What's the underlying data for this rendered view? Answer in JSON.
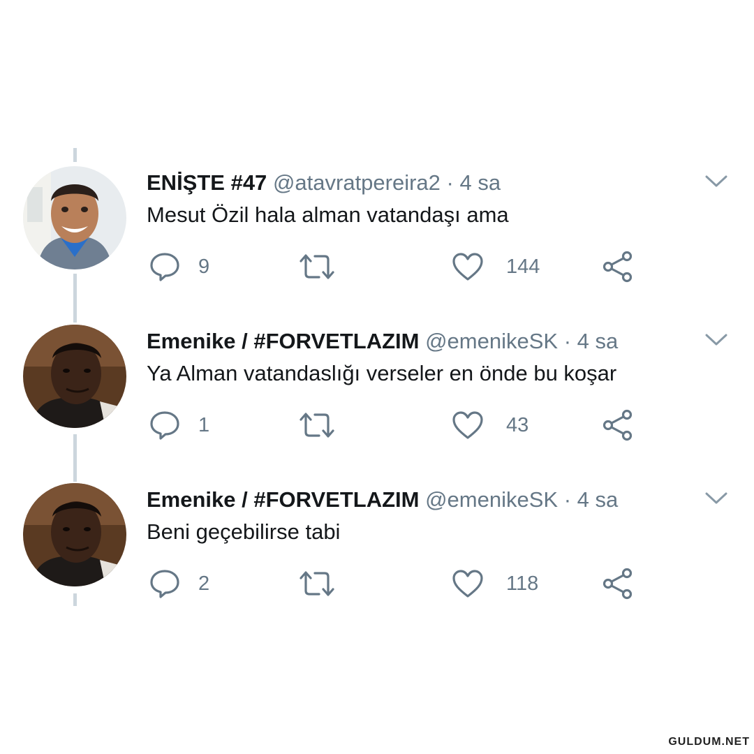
{
  "tweets": [
    {
      "name": "ENİŞTE #47",
      "handle": "@atavratpereira2",
      "separator": "·",
      "time": "4 sa",
      "text": "Mesut Özil hala alman vatandaşı ama",
      "replies": "9",
      "retweets": "",
      "likes": "144"
    },
    {
      "name": "Emenike / #FORVETLAZIM",
      "handle": "@emenikeSK",
      "separator": "·",
      "time": "4 sa",
      "text": "Ya Alman vatandaslığı verseler en önde bu koşar",
      "replies": "1",
      "retweets": "",
      "likes": "43"
    },
    {
      "name": "Emenike / #FORVETLAZIM",
      "handle": "@emenikeSK",
      "separator": "·",
      "time": "4 sa",
      "text": "Beni geçebilirse tabi",
      "replies": "2",
      "retweets": "",
      "likes": "118"
    }
  ],
  "icons": {
    "reply": "reply-icon",
    "retweet": "retweet-icon",
    "like": "heart-icon",
    "share": "share-icon",
    "caret": "chevron-down-icon"
  },
  "colors": {
    "text": "#14171a",
    "secondary": "#657786",
    "thread_line": "#ccd6dd"
  },
  "watermark": "GULDUM.NET"
}
